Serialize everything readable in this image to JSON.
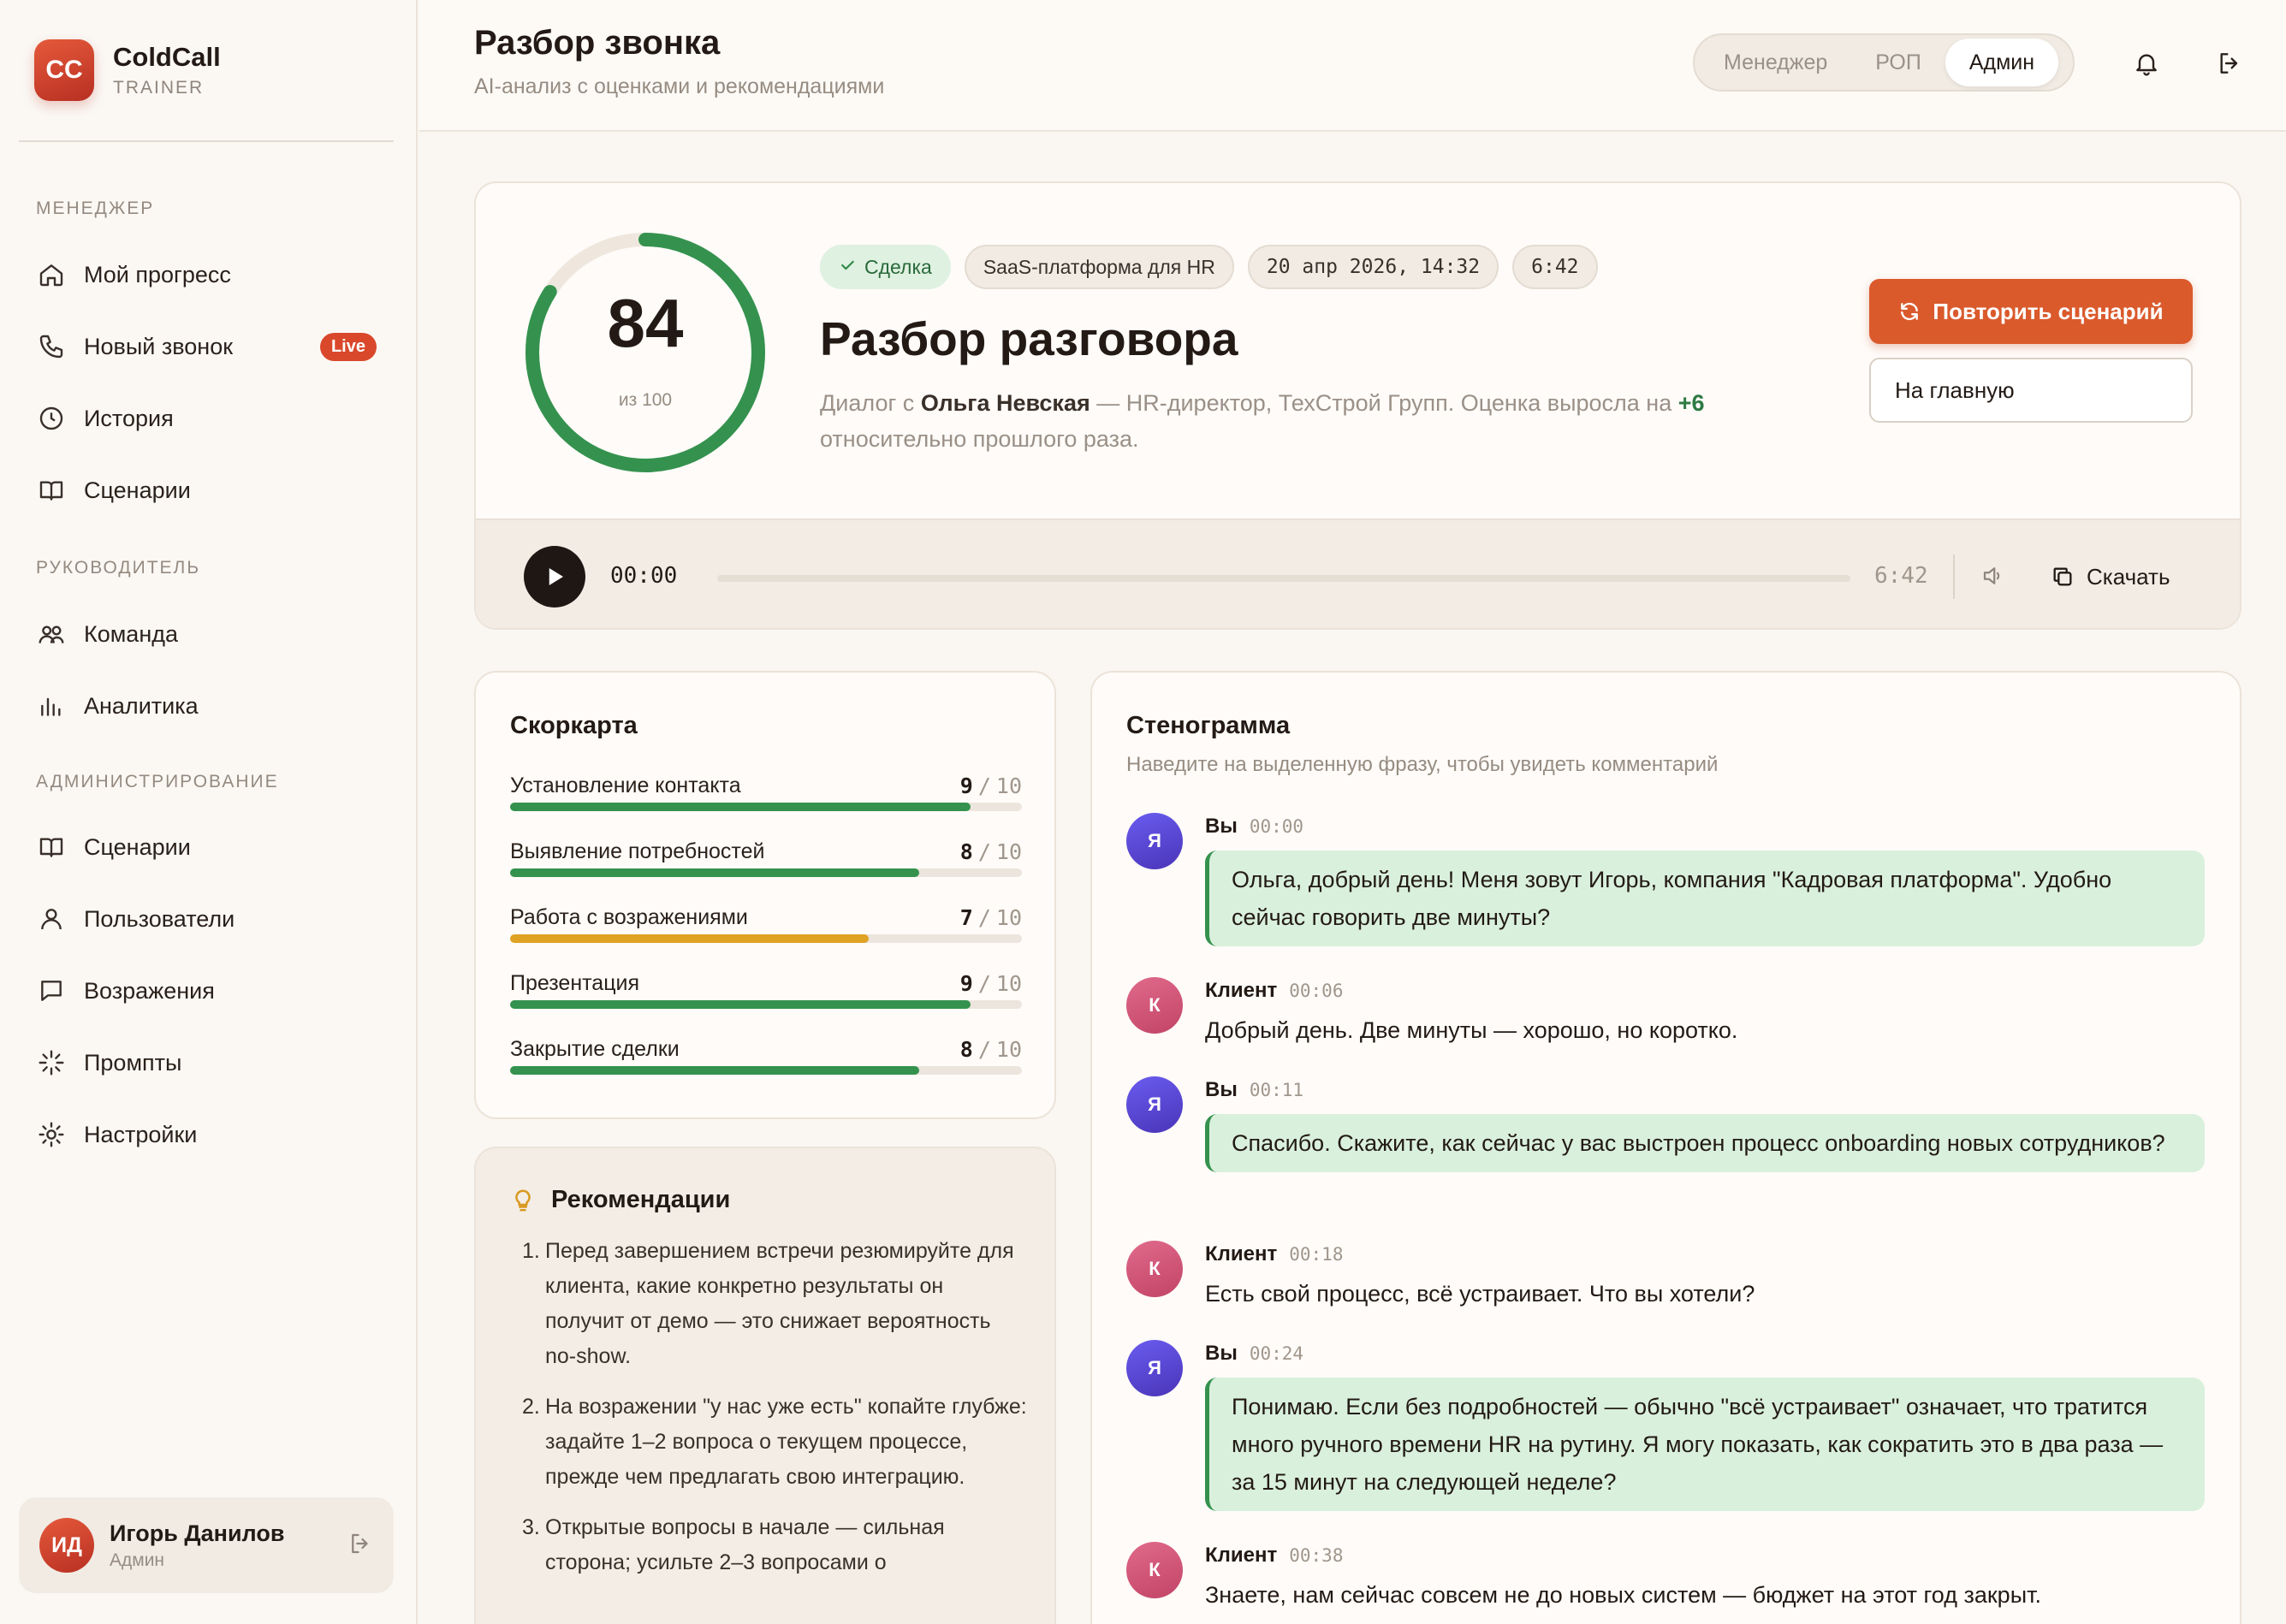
{
  "brand": {
    "logo": "CC",
    "name": "ColdCall",
    "sub": "TRAINER"
  },
  "sidebar": {
    "sections": [
      {
        "label": "МЕНЕДЖЕР",
        "items": [
          {
            "label": "Мой прогресс",
            "icon": "home-icon"
          },
          {
            "label": "Новый звонок",
            "icon": "phone-icon",
            "badge": "Live"
          },
          {
            "label": "История",
            "icon": "clock-icon"
          },
          {
            "label": "Сценарии",
            "icon": "book-icon"
          }
        ]
      },
      {
        "label": "РУКОВОДИТЕЛЬ",
        "items": [
          {
            "label": "Команда",
            "icon": "team-icon"
          },
          {
            "label": "Аналитика",
            "icon": "chart-icon"
          }
        ]
      },
      {
        "label": "АДМИНИСТРИРОВАНИЕ",
        "items": [
          {
            "label": "Сценарии",
            "icon": "book-icon"
          },
          {
            "label": "Пользователи",
            "icon": "user-icon"
          },
          {
            "label": "Возражения",
            "icon": "message-icon"
          },
          {
            "label": "Промпты",
            "icon": "sparkle-icon"
          },
          {
            "label": "Настройки",
            "icon": "gear-icon"
          }
        ]
      }
    ],
    "user": {
      "initials": "ИД",
      "name": "Игорь Данилов",
      "role": "Админ"
    }
  },
  "header": {
    "title": "Разбор звонка",
    "subtitle": "AI-анализ с оценками и рекомендациями",
    "roles": [
      "Менеджер",
      "РОП",
      "Админ"
    ],
    "active_role": "Админ"
  },
  "summary": {
    "score": "84",
    "score_value": 84,
    "score_max": 100,
    "score_of": "из 100",
    "chips": {
      "deal": "Сделка",
      "scenario": "SaaS-платформа для HR",
      "date": "20 апр 2026, 14:32",
      "duration": "6:42"
    },
    "title": "Разбор разговора",
    "desc_prefix": "Диалог с ",
    "contact": "Ольга Невская",
    "desc_middle": " — HR-директор, ТехСтрой Групп. Оценка выросла на ",
    "delta": "+6",
    "desc_suffix": " относительно прошлого раза.",
    "repeat_button": "Повторить сценарий",
    "home_button": "На главную",
    "player": {
      "current": "00:00",
      "duration": "6:42",
      "download": "Скачать",
      "progress": 0
    }
  },
  "scorecard": {
    "title": "Скоркарта",
    "max": "10",
    "items": [
      {
        "name": "Установление контакта",
        "score": "9",
        "value": 9,
        "color": "#34924e"
      },
      {
        "name": "Выявление потребностей",
        "score": "8",
        "value": 8,
        "color": "#34924e"
      },
      {
        "name": "Работа с возражениями",
        "score": "7",
        "value": 7,
        "color": "#e0a224"
      },
      {
        "name": "Презентация",
        "score": "9",
        "value": 9,
        "color": "#34924e"
      },
      {
        "name": "Закрытие сделки",
        "score": "8",
        "value": 8,
        "color": "#34924e"
      }
    ]
  },
  "recommendations": {
    "title": "Рекомендации",
    "items": [
      "Перед завершением встречи резюмируйте для клиента, какие конкретно результаты он получит от демо — это снижает вероятность no-show.",
      "На возражении \"у нас уже есть\" копайте глубже: задайте 1–2 вопроса о текущем процессе, прежде чем предлагать свою интеграцию.",
      "Открытые вопросы в начале — сильная сторона; усильте 2–3 вопросами о"
    ]
  },
  "transcript": {
    "title": "Стенограмма",
    "subtitle": "Наведите на выделенную фразу, чтобы увидеть комментарий",
    "messages": [
      {
        "who": "Вы",
        "avatar": "Я",
        "time": "00:00",
        "text": "Ольга, добрый день! Меня зовут Игорь, компания \"Кадровая платформа\". Удобно сейчас говорить две минуты?",
        "highlight": true
      },
      {
        "who": "Клиент",
        "avatar": "К",
        "time": "00:06",
        "text": "Добрый день. Две минуты — хорошо, но коротко.",
        "highlight": false
      },
      {
        "who": "Вы",
        "avatar": "Я",
        "time": "00:11",
        "text": "Спасибо. Скажите, как сейчас у вас выстроен процесс onboarding новых сотрудников?",
        "highlight": true
      },
      {
        "who": "Клиент",
        "avatar": "К",
        "time": "00:18",
        "text": "Есть свой процесс, всё устраивает. Что вы хотели?",
        "highlight": false
      },
      {
        "who": "Вы",
        "avatar": "Я",
        "time": "00:24",
        "text": "Понимаю. Если без подробностей — обычно \"всё устраивает\" означает, что тратится много ручного времени HR на рутину. Я могу показать, как сократить это в два раза — за 15 минут на следующей неделе?",
        "highlight": true
      },
      {
        "who": "Клиент",
        "avatar": "К",
        "time": "00:38",
        "text": "Знаете, нам сейчас совсем не до новых систем — бюджет на этот год закрыт.",
        "highlight": false
      }
    ]
  }
}
